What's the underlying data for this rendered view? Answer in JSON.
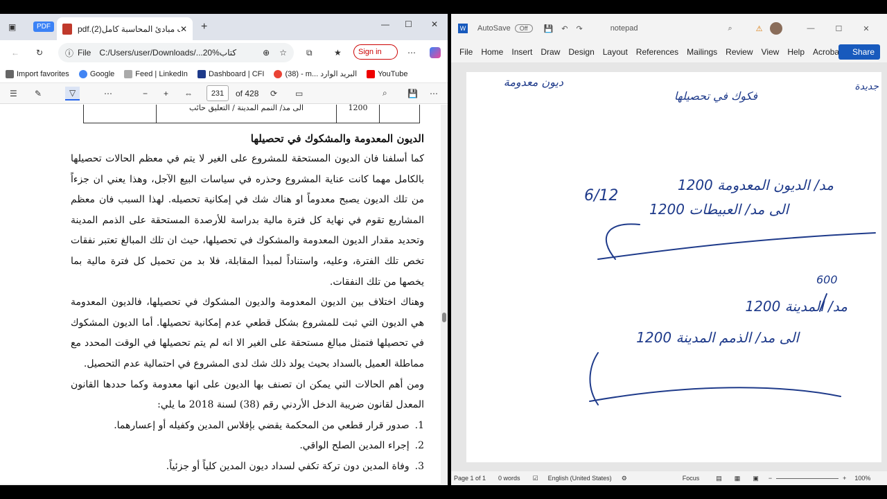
{
  "browser": {
    "pdf_tab_badge": "PDF",
    "tab_title": "pdf.(2)كتاب مبادئ المحاسبة كامل*",
    "url": "C:/Users/user/Downloads/...20%كتاب",
    "file_label": "File",
    "signin": "Sign in",
    "favorites": [
      "Import favorites",
      "Google",
      "Feed | LinkedIn",
      "Dashboard | CFI",
      "(38) - m... البريد الوارد",
      "YouTube"
    ],
    "page_current": "231",
    "page_total": "of 428"
  },
  "document": {
    "table_row": [
      "1200",
      "الى مذ/ النمم المدينة / التعليق حائب"
    ],
    "heading": "الديون المعدومة والمشكوك في تحصيلها",
    "para1": "كما أسلفنا فان الديون المستحقة للمشروع على الغير لا يتم في معظم الحالات تحصيلها بالكامل مهما كانت عناية المشروع وحذره في سياسات البيع الآجل، وهذا يعني ان جزءاً من تلك الديون يصبح معدوماً او هناك شك في إمكانية تحصيله. لهذا السبب فان معظم المشاريع تقوم في نهاية كل فترة مالية بدراسة للأرصدة المستحقة على الذمم المدينة وتحديد مقدار الديون المعدومة والمشكوك في تحصيلها، حيث ان تلك المبالغ تعتبر نفقات تخص تلك الفترة، وعليه، واستناداً لمبدأ المقابلة، فلا بد من تحميل كل فترة مالية بما يخصها من تلك النفقات.",
    "para2": "وهناك اختلاف بين الديون المعدومة والديون المشكوك في تحصيلها، فالديون المعدومة هي الديون التي ثبت للمشروع بشكل قطعي عدم إمكانية تحصيلها. أما الديون المشكوك في تحصيلها فتمثل مبالغ مستحقة على الغير الا انه لم يتم تحصيلها في الوقت المحدد مع مماطلة العميل بالسداد بحيث يولد ذلك شك لدى المشروع في احتمالية عدم التحصيل.",
    "para3": "ومن أهم الحالات التي يمكن ان تصنف بها الديون على انها معدومة وكما حددها القانون المعدل لقانون ضريبة الدخل الأردني رقم (38) لسنة 2018 ما يلي:",
    "items": [
      {
        "num": "1.",
        "text": "صدور قرار قطعي من المحكمة يقضي بإفلاس المدين وكفيله أو إعسارهما."
      },
      {
        "num": "2.",
        "text": "إجراء المدين الصلح الواقي."
      },
      {
        "num": "3.",
        "text": "وفاة المدين دون تركة تكفي لسداد ديون المدين كلياً أو جزئياً."
      }
    ]
  },
  "word": {
    "autosave": "AutoSave",
    "autosave_state": "Off",
    "doc_name": "notepad",
    "menu": [
      "File",
      "Home",
      "Insert",
      "Draw",
      "Design",
      "Layout",
      "References",
      "Mailings",
      "Review",
      "View",
      "Help",
      "Acrobat"
    ],
    "share": "Share",
    "handwriting": [
      "ديون معدومة",
      "فكوك في تحصيلها",
      "جديدة",
      "6/12",
      "1200 مد/ الديون المعدومة",
      "1200 الى مد/ العبيطات",
      "600",
      "1200 مد/ المدينة",
      "1200 الى مد/ الذمم المدينة"
    ],
    "status": {
      "page": "Page 1 of 1",
      "words": "0 words",
      "lang": "English (United States)",
      "focus": "Focus",
      "zoom": "100%"
    }
  }
}
